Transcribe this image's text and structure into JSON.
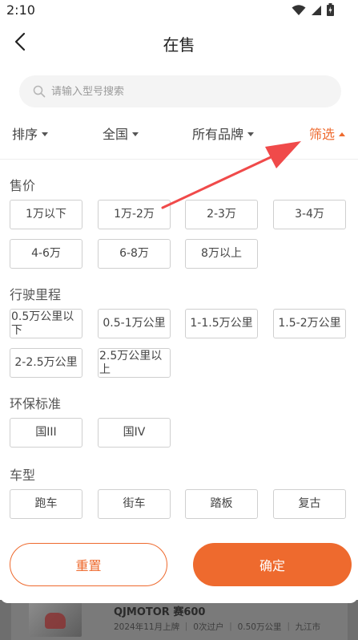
{
  "status_bar": {
    "time": "2:10"
  },
  "header": {
    "title": "在售"
  },
  "search": {
    "placeholder": "请输入型号搜索"
  },
  "filter_tabs": [
    {
      "label": "排序",
      "active": false
    },
    {
      "label": "全国",
      "active": false
    },
    {
      "label": "所有品牌",
      "active": false
    },
    {
      "label": "筛选",
      "active": true
    }
  ],
  "sections": {
    "price": {
      "title": "售价",
      "options": [
        "1万以下",
        "1万-2万",
        "2-3万",
        "3-4万",
        "4-6万",
        "6-8万",
        "8万以上"
      ]
    },
    "mileage": {
      "title": "行驶里程",
      "options": [
        "0.5万公里以下",
        "0.5-1万公里",
        "1-1.5万公里",
        "1.5-2万公里",
        "2-2.5万公里",
        "2.5万公里以上"
      ]
    },
    "emission": {
      "title": "环保标准",
      "options": [
        "国III",
        "国IV"
      ]
    },
    "vehicle_type": {
      "title": "车型",
      "options": [
        "跑车",
        "街车",
        "踏板",
        "复古"
      ]
    }
  },
  "actions": {
    "reset_label": "重置",
    "confirm_label": "确定"
  },
  "listing_preview": {
    "name": "QJMOTOR 赛600",
    "meta": "2024年11月上牌 ｜ 0次过户 ｜ 0.50万公里 ｜ 九江市"
  },
  "colors": {
    "accent": "#ee6a2e",
    "annotation_arrow": "#f04a4a"
  }
}
